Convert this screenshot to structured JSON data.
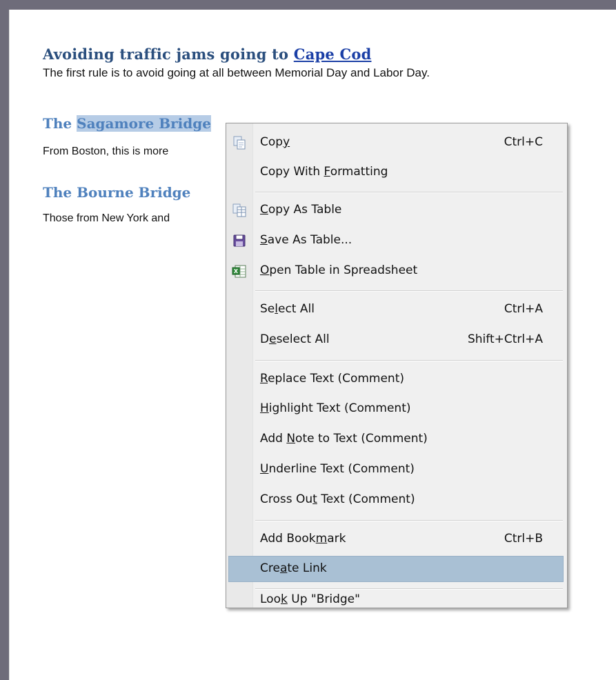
{
  "document": {
    "heading1_prefix": "Avoiding traffic jams going to ",
    "heading1_link": "Cape Cod",
    "para1": "The first rule is to avoid going at all between Memorial Day and Labor Day.",
    "heading2_before": "The ",
    "heading2_selected": "Sagamore Bridge",
    "para2": "From Boston, this is more",
    "heading3": "The Bourne Bridge",
    "para3": "Those from New York and"
  },
  "context_menu": {
    "items": [
      {
        "label_pre": "Cop",
        "mnemonic": "y",
        "label_post": "",
        "shortcut": "Ctrl+C",
        "icon": "copy-icon"
      },
      {
        "label_pre": "Copy With ",
        "mnemonic": "F",
        "label_post": "ormatting",
        "shortcut": ""
      },
      {
        "label_pre": "",
        "mnemonic": "C",
        "label_post": "opy As Table",
        "shortcut": "",
        "icon": "copy-table-icon"
      },
      {
        "label_pre": "",
        "mnemonic": "S",
        "label_post": "ave As Table...",
        "shortcut": "",
        "icon": "save-icon"
      },
      {
        "label_pre": "",
        "mnemonic": "O",
        "label_post": "pen Table in Spreadsheet",
        "shortcut": "",
        "icon": "spreadsheet-icon"
      },
      {
        "label_pre": "Se",
        "mnemonic": "l",
        "label_post": "ect All",
        "shortcut": "Ctrl+A"
      },
      {
        "label_pre": "D",
        "mnemonic": "e",
        "label_post": "select All",
        "shortcut": "Shift+Ctrl+A"
      },
      {
        "label_pre": "",
        "mnemonic": "R",
        "label_post": "eplace Text (Comment)",
        "shortcut": ""
      },
      {
        "label_pre": "",
        "mnemonic": "H",
        "label_post": "ighlight Text (Comment)",
        "shortcut": ""
      },
      {
        "label_pre": "Add ",
        "mnemonic": "N",
        "label_post": "ote to Text (Comment)",
        "shortcut": ""
      },
      {
        "label_pre": "",
        "mnemonic": "U",
        "label_post": "nderline Text (Comment)",
        "shortcut": ""
      },
      {
        "label_pre": "Cross Ou",
        "mnemonic": "t",
        "label_post": " Text (Comment)",
        "shortcut": ""
      },
      {
        "label_pre": "Add Book",
        "mnemonic": "m",
        "label_post": "ark",
        "shortcut": "Ctrl+B"
      },
      {
        "label_pre": "Cre",
        "mnemonic": "a",
        "label_post": "te Link",
        "shortcut": "",
        "highlighted": true
      },
      {
        "label_pre": "Loo",
        "mnemonic": "k",
        "label_post": " Up \"Bridge\"",
        "shortcut": ""
      }
    ]
  },
  "colors": {
    "heading_dark": "#2b4f7e",
    "heading_light": "#4f81bd",
    "selection": "#b6cce6",
    "menu_highlight": "#a9c0d4"
  }
}
